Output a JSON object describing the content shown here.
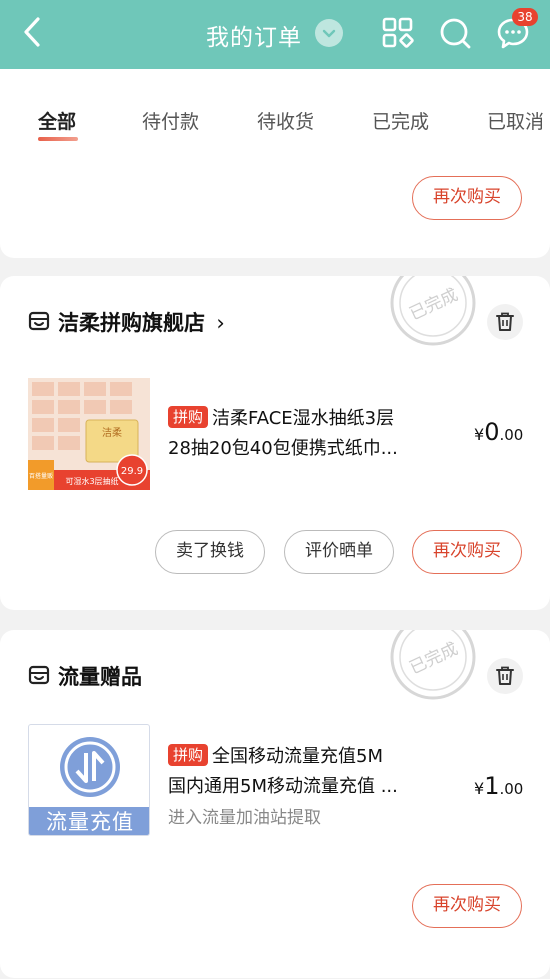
{
  "header": {
    "title": "我的订单",
    "message_badge": "38",
    "accent_color": "#6fc7b9",
    "icons": [
      "back-arrow-icon",
      "dropdown-chevron-icon",
      "grid-apps-icon",
      "search-icon",
      "chat-icon"
    ]
  },
  "tabs": [
    {
      "label": "全部",
      "active": true
    },
    {
      "label": "待付款",
      "active": false
    },
    {
      "label": "待收货",
      "active": false
    },
    {
      "label": "已完成",
      "active": false
    },
    {
      "label": "已取消",
      "active": false
    }
  ],
  "orders": [
    {
      "buttons": [
        "再次购买"
      ]
    },
    {
      "store": "洁柔拼购旗舰店",
      "store_arrow": "›",
      "status_stamp": "已完成",
      "product": {
        "tag": "拼购",
        "name_line1": "洁柔FACE湿水抽纸3层",
        "name_line2": "28抽20包40包便携式纸巾...",
        "price_currency": "¥",
        "price_int": "0",
        "price_dec": ".00",
        "image_texts": {
          "brand": "洁柔",
          "price_badge": "29.9",
          "banner": "可湿水3层抽纸",
          "corner": "百搭量贩"
        }
      },
      "buttons": [
        "卖了换钱",
        "评价晒单",
        "再次购买"
      ]
    },
    {
      "store": "流量赠品",
      "status_stamp": "已完成",
      "product": {
        "tag": "拼购",
        "name_line1": "全国移动流量充值5M",
        "name_line2": "国内通用5M移动流量充值 ...",
        "subtitle": "进入流量加油站提取",
        "price_currency": "¥",
        "price_int": "1",
        "price_dec": ".00",
        "image_label": "流量充值"
      },
      "buttons": [
        "再次购买"
      ]
    }
  ]
}
